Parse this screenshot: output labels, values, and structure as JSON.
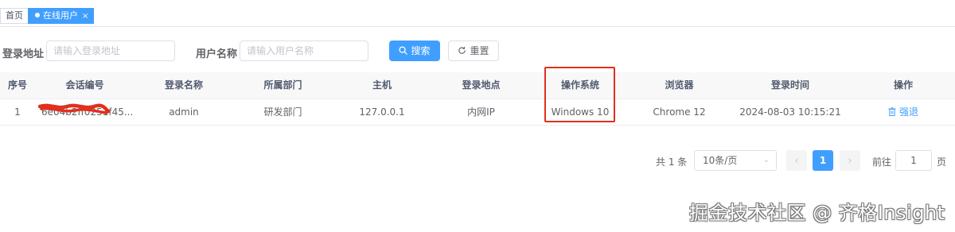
{
  "tags": {
    "home": "首页",
    "active": "在线用户",
    "close": "×"
  },
  "search": {
    "address_label": "登录地址",
    "address_placeholder": "请输入登录地址",
    "username_label": "用户名称",
    "username_placeholder": "请输入用户名称",
    "search_button": "搜索",
    "reset_button": "重置"
  },
  "table": {
    "columns": [
      "序号",
      "会话编号",
      "登录名称",
      "所属部门",
      "主机",
      "登录地点",
      "操作系统",
      "浏览器",
      "登录时间",
      "操作"
    ],
    "rows": [
      {
        "index": "1",
        "session_id": "6e04b2ff0251f45...",
        "login_name": "admin",
        "dept": "研发部门",
        "host": "127.0.0.1",
        "location": "内网IP",
        "os": "Windows 10",
        "browser": "Chrome 12",
        "login_time": "2024-08-03 10:15:21",
        "action": "强退"
      }
    ]
  },
  "pagination": {
    "total": "共 1 条",
    "page_size": "10条/页",
    "prev": "‹",
    "current_page": "1",
    "next": "›",
    "goto_label": "前往",
    "goto_value": "1",
    "goto_suffix": "页"
  },
  "watermark": "掘金技术社区 @ 齐格Insight",
  "colors": {
    "primary": "#409eff",
    "highlight": "#e0301e",
    "header_bg": "#f8f8f9"
  }
}
